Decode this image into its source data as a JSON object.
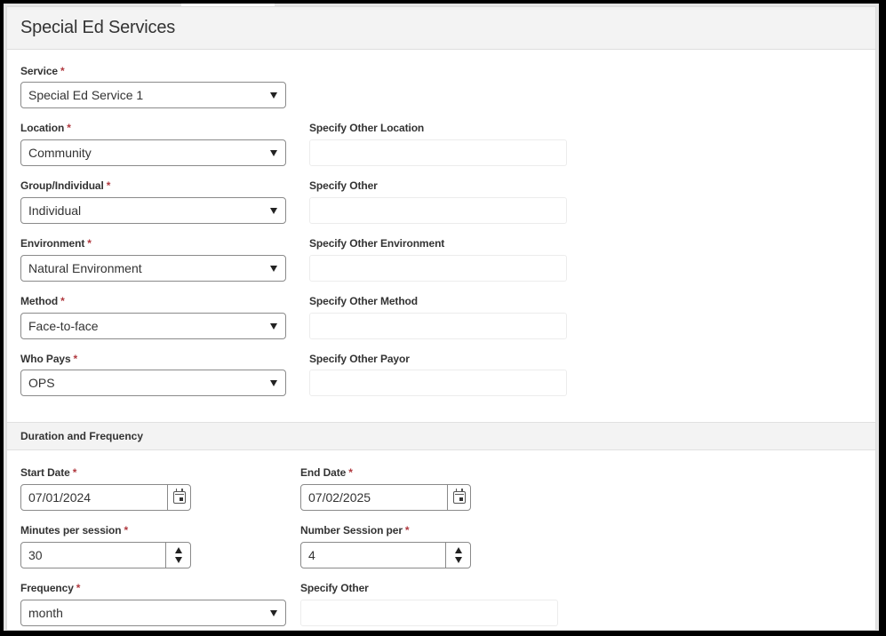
{
  "panel": {
    "title": "Special Ed Services"
  },
  "required_marker": "*",
  "fields": {
    "service": {
      "label": "Service",
      "value": "Special Ed Service 1"
    },
    "location": {
      "label": "Location",
      "value": "Community",
      "other_label": "Specify Other Location",
      "other_value": ""
    },
    "group": {
      "label": "Group/Individual",
      "value": "Individual",
      "other_label": "Specify Other",
      "other_value": ""
    },
    "environment": {
      "label": "Environment",
      "value": "Natural Environment",
      "other_label": "Specify Other Environment",
      "other_value": ""
    },
    "method": {
      "label": "Method",
      "value": "Face-to-face",
      "other_label": "Specify Other Method",
      "other_value": ""
    },
    "who_pays": {
      "label": "Who Pays",
      "value": "OPS",
      "other_label": "Specify Other Payor",
      "other_value": ""
    }
  },
  "duration": {
    "title": "Duration and Frequency",
    "start_date": {
      "label": "Start Date",
      "value": "07/01/2024"
    },
    "end_date": {
      "label": "End Date",
      "value": "07/02/2025"
    },
    "minutes": {
      "label": "Minutes per session",
      "value": "30"
    },
    "sessions": {
      "label": "Number Session per",
      "value": "4"
    },
    "frequency": {
      "label": "Frequency",
      "value": "month",
      "other_label": "Specify Other",
      "other_value": ""
    }
  },
  "icons": {
    "select_arrow": "caret-down-icon",
    "calendar": "calendar-icon",
    "spinner": "spinner-arrows-icon"
  }
}
